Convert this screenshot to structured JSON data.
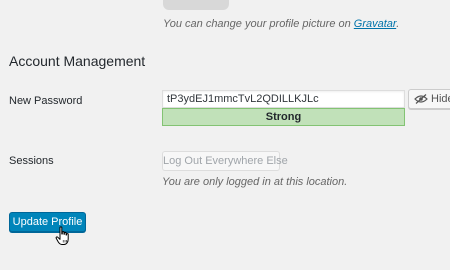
{
  "avatar": {
    "description_prefix": "You can change your profile picture on ",
    "gravatar_link": "Gravatar",
    "description_suffix": "."
  },
  "account_management": {
    "title": "Account Management",
    "new_password": {
      "label": "New Password",
      "value": "tP3ydEJ1mmcTvL2QDILLKJLc",
      "strength": "Strong",
      "toggle_label": "Hide",
      "toggle_icon": "eye-slash-icon"
    },
    "sessions": {
      "label": "Sessions",
      "button_label": "Log Out Everywhere Else",
      "description": "You are only logged in at this location."
    }
  },
  "footer": {
    "update_button": "Update Profile"
  },
  "colors": {
    "primary": "#0085ba",
    "strength_strong_bg": "#c1e1b9",
    "strength_strong_border": "#83c373",
    "link": "#0073aa"
  }
}
